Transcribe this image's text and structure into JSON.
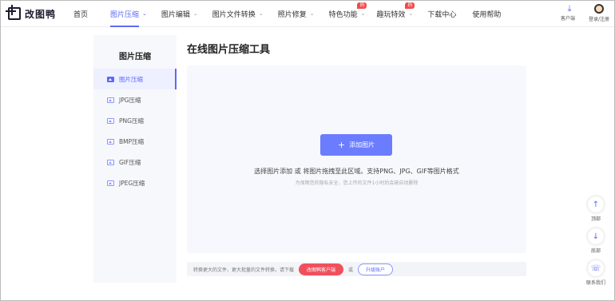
{
  "app": {
    "logo_text": "改图鸭"
  },
  "nav": {
    "items": [
      {
        "label": "首页",
        "chevron": false,
        "badge": "",
        "active": false
      },
      {
        "label": "图片压缩",
        "chevron": true,
        "badge": "",
        "active": true
      },
      {
        "label": "图片编辑",
        "chevron": true,
        "badge": "",
        "active": false
      },
      {
        "label": "图片文件转换",
        "chevron": true,
        "badge": "",
        "active": false
      },
      {
        "label": "照片修复",
        "chevron": true,
        "badge": "",
        "active": false
      },
      {
        "label": "特色功能",
        "chevron": true,
        "badge": "热",
        "active": false
      },
      {
        "label": "趣玩特效",
        "chevron": true,
        "badge": "热",
        "active": false
      },
      {
        "label": "下载中心",
        "chevron": false,
        "badge": "",
        "active": false
      },
      {
        "label": "使用帮助",
        "chevron": false,
        "badge": "",
        "active": false
      }
    ],
    "client_label": "客户端",
    "login_label": "登录/注册"
  },
  "sidebar": {
    "title": "图片压缩",
    "items": [
      {
        "label": "图片压缩",
        "active": true
      },
      {
        "label": "JPG压缩",
        "active": false
      },
      {
        "label": "PNG压缩",
        "active": false
      },
      {
        "label": "BMP压缩",
        "active": false
      },
      {
        "label": "GIF压缩",
        "active": false
      },
      {
        "label": "JPEG压缩",
        "active": false
      }
    ]
  },
  "main": {
    "title": "在线图片压缩工具",
    "add_button_label": "添加图片",
    "hint_main": "选择图片添加 或 将图片拖拽至此区域。支持PNG、JPG、GIF等图片格式",
    "hint_sub": "为保障您的隐私安全，您上传的文件1小时后会被自动删除"
  },
  "bottom_bar": {
    "text": "转换更大的文件、更大批量的文件转换，请下载",
    "client_button": "改图鸭客户端",
    "or_text": "或",
    "upgrade_button": "升级账户"
  },
  "float_tools": {
    "top_label": "顶部",
    "bottom_label": "底部",
    "contact_label": "联系我们"
  },
  "colors": {
    "accent": "#5c6af8",
    "add_button": "#6b7cff",
    "client_button": "#f0505c",
    "badge": "#f24b4b"
  }
}
